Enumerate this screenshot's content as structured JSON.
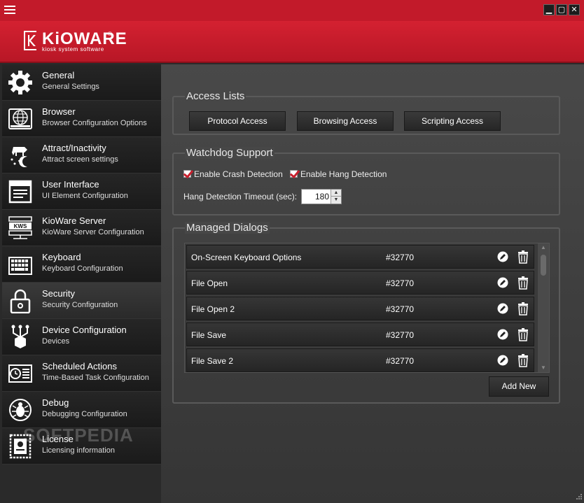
{
  "window": {
    "minimize": "▁",
    "maximize": "▢",
    "close": "✕"
  },
  "brand": {
    "name": "KiOWARE",
    "tagline": "kiosk system software",
    "reg": "®"
  },
  "sidebar": {
    "items": [
      {
        "title": "General",
        "subtitle": "General Settings",
        "icon": "gear-icon"
      },
      {
        "title": "Browser",
        "subtitle": "Browser Configuration Options",
        "icon": "browser-globe-icon"
      },
      {
        "title": "Attract/Inactivity",
        "subtitle": "Attract screen settings",
        "icon": "cow-moon-icon"
      },
      {
        "title": "User Interface",
        "subtitle": "UI Element Configuration",
        "icon": "window-icon"
      },
      {
        "title": "KioWare Server",
        "subtitle": "KioWare Server Configuration",
        "icon": "server-icon",
        "badge": "KWS"
      },
      {
        "title": "Keyboard",
        "subtitle": "Keyboard Configuration",
        "icon": "keyboard-icon"
      },
      {
        "title": "Security",
        "subtitle": "Security Configuration",
        "icon": "lock-icon"
      },
      {
        "title": "Device Configuration",
        "subtitle": "Devices",
        "icon": "devices-icon"
      },
      {
        "title": "Scheduled Actions",
        "subtitle": "Time-Based Task Configuration",
        "icon": "clock-list-icon"
      },
      {
        "title": "Debug",
        "subtitle": "Debugging Configuration",
        "icon": "bug-icon"
      },
      {
        "title": "License",
        "subtitle": "Licensing information",
        "icon": "certificate-icon"
      }
    ],
    "active_index": 6
  },
  "watermark": "SOFTPEDIA",
  "access_lists": {
    "title": "Access Lists",
    "protocol": "Protocol Access",
    "browsing": "Browsing Access",
    "scripting": "Scripting Access"
  },
  "watchdog": {
    "title": "Watchdog Support",
    "crash": "Enable Crash Detection",
    "hang": "Enable Hang Detection",
    "timeout_label": "Hang Detection Timeout (sec):",
    "timeout_value": "180"
  },
  "dialogs": {
    "title": "Managed Dialogs",
    "rows": [
      {
        "name": "On-Screen Keyboard Options",
        "id": "#32770"
      },
      {
        "name": "File Open",
        "id": "#32770"
      },
      {
        "name": "File Open 2",
        "id": "#32770"
      },
      {
        "name": "File Save",
        "id": "#32770"
      },
      {
        "name": "File Save 2",
        "id": "#32770"
      }
    ],
    "add_label": "Add New"
  },
  "colors": {
    "accent": "#c21a2a",
    "header": "#d42131"
  }
}
